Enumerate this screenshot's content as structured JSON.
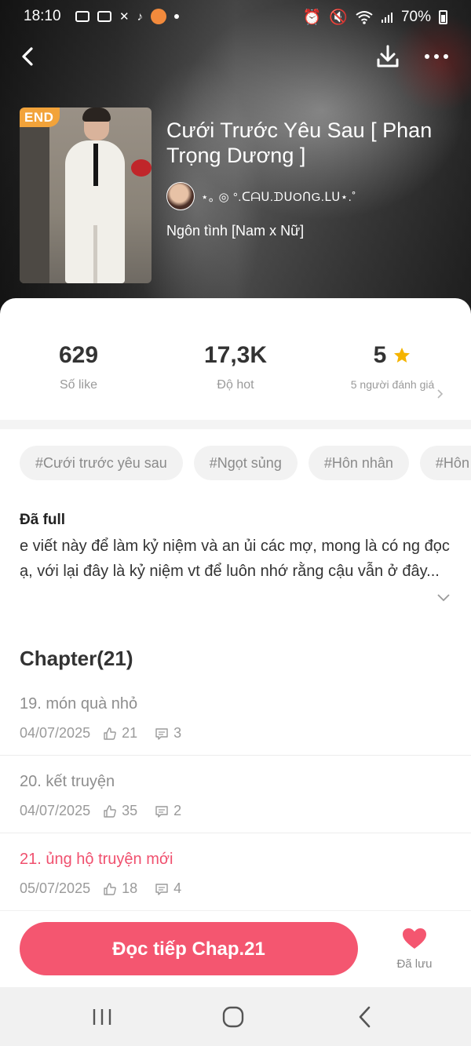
{
  "status_bar": {
    "time": "18:10",
    "battery": "70%",
    "icons_left": [
      "message-icon",
      "youtube-icon",
      "missed-call-icon",
      "tiktok-icon",
      "orange-app-icon",
      "dot-icon"
    ],
    "icons_right": [
      "alarm-icon",
      "mute-icon",
      "wifi-icon",
      "signal-icon",
      "battery-icon"
    ]
  },
  "header": {
    "back_icon": "back-arrow-icon",
    "download_icon": "download-icon",
    "more_icon": "more-dots-icon"
  },
  "book": {
    "badge": "END",
    "title": "Cưới Trước Yêu Sau [ Phan Trọng Dương ]",
    "author": "⋆｡ ◎ °.ᑕᗩᑌ.ᗪᑌOᑎG.ᒪᑌ⋆.˚",
    "genre": "Ngôn tình [Nam x Nữ]"
  },
  "stats": {
    "likes": {
      "value": "629",
      "label": "Số like"
    },
    "hot": {
      "value": "17,3K",
      "label": "Độ hot"
    },
    "rating": {
      "value": "5",
      "label": "5 người đánh giá"
    }
  },
  "tags": [
    "#Cưới trước yêu sau",
    "#Ngọt sủng",
    "#Hôn nhân",
    "#Hôn nhân"
  ],
  "description": {
    "status": "Đã full",
    "text": "e viết này để làm kỷ niệm và an ủi các mợ, mong là có ng đọc ạ, với lại đây là kỷ niệm vt để luôn nhớ rằng cậu vẫn ở đây..."
  },
  "chapters": {
    "heading": "Chapter(21)",
    "items": [
      {
        "name": "19. món quà nhỏ",
        "date": "04/07/2025",
        "likes": "21",
        "comments": "3"
      },
      {
        "name": "20. kết truyện",
        "date": "04/07/2025",
        "likes": "35",
        "comments": "2"
      },
      {
        "name": "21. ủng hộ truyện mới",
        "date": "05/07/2025",
        "likes": "18",
        "comments": "4"
      }
    ]
  },
  "actions": {
    "read_label": "Đọc tiếp Chap.21",
    "saved_label": "Đã lưu"
  },
  "colors": {
    "accent": "#f45670",
    "active_chapter": "#f0506e",
    "star": "#f5b400",
    "end_badge": "#f2a33a"
  }
}
